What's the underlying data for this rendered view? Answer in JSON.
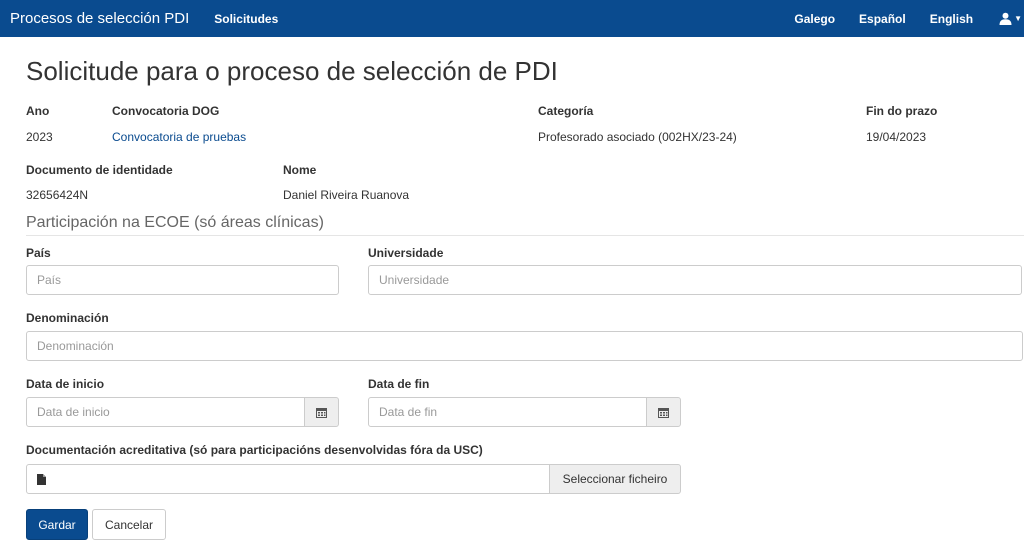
{
  "navbar": {
    "brand": "Procesos de selección PDI",
    "solicitudes": "Solicitudes",
    "languages": [
      "Galego",
      "Español",
      "English"
    ],
    "user_icon": "user-icon"
  },
  "page": {
    "title": "Solicitude para o proceso de selección de PDI"
  },
  "info": {
    "ano_label": "Ano",
    "ano_value": "2023",
    "convocatoria_label": "Convocatoria DOG",
    "convocatoria_value": "Convocatoria de pruebas",
    "categoria_label": "Categoría",
    "categoria_value": "Profesorado asociado (002HX/23-24)",
    "fin_label": "Fin do prazo",
    "fin_value": "19/04/2023",
    "documento_label": "Documento de identidade",
    "documento_value": "32656424N",
    "nome_label": "Nome",
    "nome_value": "Daniel Riveira Ruanova"
  },
  "form": {
    "section_title": "Participación na ECOE (só áreas clínicas)",
    "pais_label": "País",
    "pais_placeholder": "País",
    "universidade_label": "Universidade",
    "universidade_placeholder": "Universidade",
    "denominacion_label": "Denominación",
    "denominacion_placeholder": "Denominación",
    "data_inicio_label": "Data de inicio",
    "data_inicio_placeholder": "Data de inicio",
    "data_fin_label": "Data de fin",
    "data_fin_placeholder": "Data de fin",
    "documentacion_label": "Documentación acreditativa (só para participacións desenvolvidas fóra da USC)",
    "file_button": "Seleccionar ficheiro"
  },
  "actions": {
    "save": "Gardar",
    "cancel": "Cancelar"
  },
  "colors": {
    "navbar": "#0a4b8f",
    "link": "#0a4b8f",
    "primary": "#0a4b8f"
  }
}
